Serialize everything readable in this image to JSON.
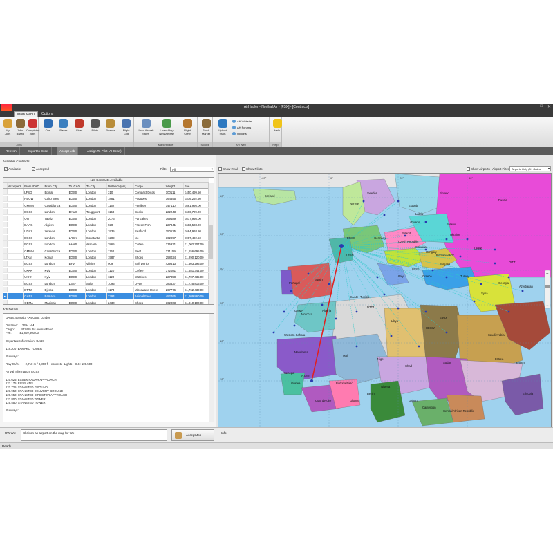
{
  "window": {
    "title": "AirHauler - NorthallAir - [FSX] - [Contracts]",
    "controls": [
      "–",
      "□",
      "✕"
    ]
  },
  "menu_tabs": [
    "Main Menu",
    "Options"
  ],
  "ribbon": {
    "groups": [
      {
        "label": "Jobs",
        "buttons": [
          {
            "label": "My\nJobs",
            "icon": "my-jobs-icon",
            "color": "#d9a23a"
          },
          {
            "label": "Jobs\nBoard",
            "icon": "jobs-board-icon",
            "color": "#8c6a3a"
          },
          {
            "label": "Completed\nJobs",
            "icon": "completed-jobs-icon",
            "color": "#cc3333"
          }
        ]
      },
      {
        "label": "",
        "buttons": [
          {
            "label": "Ops",
            "icon": "ops-icon",
            "color": "#2e6db4"
          },
          {
            "label": "Bases",
            "icon": "bases-icon",
            "color": "#3b7fbf"
          },
          {
            "label": "Fleet",
            "icon": "fleet-icon",
            "color": "#c0392b"
          },
          {
            "label": "Pilots",
            "icon": "pilots-icon",
            "color": "#555"
          },
          {
            "label": "Finance",
            "icon": "finance-icon",
            "color": "#b98d3a"
          },
          {
            "label": "Flight\nLog",
            "icon": "flight-log-icon",
            "color": "#4a74b0"
          }
        ]
      },
      {
        "label": "Marketplace",
        "buttons": [
          {
            "label": "Used Aircraft\nSales",
            "icon": "used-aircraft-icon",
            "color": "#6b8fbf"
          },
          {
            "label": "Lease/Buy\nNew Aircraft",
            "icon": "lease-buy-icon",
            "color": "#4a9a4a"
          },
          {
            "label": "Flight\nCrew",
            "icon": "flight-crew-icon",
            "color": "#b5772f"
          }
        ]
      },
      {
        "label": "Stocks",
        "buttons": [
          {
            "label": "Stock\nMarket",
            "icon": "stock-market-icon",
            "color": "#8a6b3a"
          }
        ]
      },
      {
        "label": "AH Web",
        "buttons": [
          {
            "label": "Upload\nStats",
            "icon": "upload-stats-icon",
            "color": "#2e79c0"
          }
        ],
        "links": [
          "AH Website",
          "AH Forums",
          "Options"
        ]
      },
      {
        "label": "Help",
        "buttons": [
          {
            "label": "Help",
            "icon": "help-icon",
            "color": "#f0c419"
          }
        ]
      }
    ]
  },
  "toolbar": [
    "Refresh",
    "Export to Excel",
    "Accept Job",
    "Assign To Pilot (AI Crew)"
  ],
  "contracts": {
    "section_label": "Available Contracts",
    "filter_available": "Available",
    "filter_accepted": "Accepted",
    "filter_label": "Filter",
    "filter_value": "All",
    "count_label": "128 Contracts Available",
    "columns": [
      "Accepted",
      "From ICAO",
      "From City",
      "To ICAO",
      "To City",
      "Distance (nm)",
      "Cargo",
      "Weight",
      "Fee"
    ],
    "rows": [
      [
        "",
        "LFSG",
        "Epinal",
        "EGSS",
        "London",
        "310",
        "Compact Discs",
        "100111",
        "£450,499.50"
      ],
      [
        "",
        "HECW",
        "Cairo West",
        "EGSS",
        "London",
        "1881",
        "Potatoes",
        "164655",
        "£576,292.50"
      ],
      [
        "",
        "GMMN",
        "Casablanca",
        "EGSS",
        "London",
        "1162",
        "Fertiliser",
        "147110",
        "£661,995.00"
      ],
      [
        "",
        "EGSS",
        "London",
        "DAUK",
        "Touggourt",
        "1158",
        "Books",
        "222243",
        "£666,729.00"
      ],
      [
        "",
        "OITT",
        "Tabriz",
        "EGSS",
        "London",
        "2076",
        "Pancakes",
        "169489",
        "£677,956.00"
      ],
      [
        "",
        "DAAG",
        "Algiers",
        "EGSS",
        "London",
        "920",
        "Frozen Fish",
        "227841",
        "£683,523.00"
      ],
      [
        "",
        "UDYZ",
        "Yerevan",
        "EGSS",
        "London",
        "1935",
        "Seafood",
        "150525",
        "£684,993.80"
      ],
      [
        "",
        "EGSS",
        "London",
        "LRCK",
        "Constanta",
        "1209",
        "Ice",
        "362997",
        "£907,492.50"
      ],
      [
        "",
        "EGSS",
        "London",
        "HHAS",
        "Asmara",
        "2865",
        "Coffee",
        "235931",
        "£1,002,707.00"
      ],
      [
        "",
        "GMMN",
        "Casablanca",
        "EGSS",
        "London",
        "1162",
        "Beef",
        "231159",
        "£1,156,695.00"
      ],
      [
        "",
        "LTAN",
        "Konya",
        "EGSS",
        "London",
        "1587",
        "Shoes",
        "258024",
        "£1,290,120.00"
      ],
      [
        "",
        "EGSS",
        "London",
        "EYVI",
        "Vilnius",
        "909",
        "Soft Drinks",
        "429513",
        "£1,503,296.00"
      ],
      [
        "",
        "UKKK",
        "Kyiv",
        "EGSS",
        "London",
        "1120",
        "Coffee",
        "372081",
        "£1,581,344.00"
      ],
      [
        "",
        "UKKK",
        "Kyiv",
        "EGSS",
        "London",
        "1120",
        "Watches",
        "227858",
        "£1,707,435.00"
      ],
      [
        "",
        "EGSS",
        "London",
        "LBSF",
        "Sofia",
        "1095",
        "DVDs",
        "383537",
        "£1,725,816.00"
      ],
      [
        "",
        "DTTJ",
        "Djerba",
        "EGSS",
        "London",
        "1173",
        "Microwave Ovens",
        "267776",
        "£1,762,432.00"
      ],
      [
        "",
        "GABS",
        "Bamako",
        "EGSS",
        "London",
        "2394",
        "Animal Feed",
        "452465",
        "£1,809,860.00"
      ],
      [
        "",
        "OEMA",
        "Madinah",
        "EGSS",
        "London",
        "2430",
        "Shoes",
        "362003",
        "£1,810,100.00"
      ]
    ],
    "selected_row": 16
  },
  "job_details": {
    "label": "Job Details",
    "lines": [
      "GABS, Bamako -> EGSS, London",
      "",
      "Distance:     2394 NM",
      "Cargo:        452465 lbs Animal Feed",
      "Fee:          £1,809,860.00",
      "",
      "Departure Information: GABS",
      "",
      "118.300  BAMAKO TOWER",
      "",
      "Runways:",
      "",
      "Rwy 06/24       2,710 m / 8,890 ft - concrete  Lights    ILS: 109.500",
      "",
      "Arrival Information: EGSS",
      "",
      "120.625  ESSEX RADAR APPROACH",
      "127.175  EGSS ATIS",
      "121.725  STANSTED GROUND",
      "121.950  STANSTED DELIVERY GROUND",
      "126.950  STANSTED DIRECTOR APPROACH",
      "123.800  STANSTED TOWER",
      "125.550  STANSTED TOWER",
      "",
      "Runways:"
    ]
  },
  "map": {
    "show_real": "Show Real",
    "show_pilots": "Show Pilots",
    "show_airports": "Show Airports",
    "airport_filter_label": "Airport Filter",
    "airport_filter_value": "Airports Only (3+ Gates)",
    "countries": [
      "Iceland",
      "Finland",
      "Sweden",
      "Norway",
      "Estonia",
      "Latvia",
      "Lithuania",
      "Belarus",
      "Russia",
      "Poland",
      "Germany",
      "Czech Republic",
      "Ukraine",
      "Slovakia",
      "Hungary",
      "Romania",
      "Bulgaria",
      "Italy",
      "Spain",
      "Portugal",
      "Greece",
      "Turkey",
      "Georgia",
      "Azerbaijan",
      "Iran",
      "Iraq",
      "Syria",
      "Jordan",
      "Egypt",
      "Libya",
      "Tunisia",
      "Algeria",
      "Morocco",
      "Western Sahara",
      "Mauritania",
      "Mali",
      "Niger",
      "Chad",
      "Sudan",
      "Nigeria",
      "Cameroon",
      "Central African Republic",
      "Ethiopia",
      "Saudi Arabia",
      "Yemen",
      "Oman",
      "Senegal",
      "Guinea",
      "Burkina Faso",
      "Cote d'Ivoire",
      "Ghana",
      "Benin",
      "Gabon",
      "Eritrea"
    ],
    "labels": [
      "Iceland",
      "Finland",
      "Sweden",
      "Norway",
      "Estonia",
      "Latvia",
      "Lithuania",
      "Belarus",
      "Russia",
      "Poland",
      "Germany",
      "Czech Republic",
      "Ukraine",
      "Slovakia",
      "Hungary",
      "Romania",
      "Bulgaria",
      "Italy",
      "Spain",
      "Portugal",
      "Greece",
      "Turkey",
      "Georgia",
      "Azerbaijan",
      "Syria",
      "Egypt",
      "Libya",
      "Tunisia",
      "Algeria",
      "Morocco",
      "Western Sahara",
      "Mauritania",
      "Mali",
      "Niger",
      "Chad",
      "Sudan",
      "Nigeria",
      "Cameroon",
      "Central African Republic",
      "Ethiopia",
      "Saudi Arabia",
      "Yemen",
      "Senegal",
      "Guinea",
      "Burkina Faso",
      "Cote d'Ivoire",
      "Ghana",
      "Benin",
      "Gabon",
      "Eritrea",
      "EGSS",
      "GABS",
      "LFSG",
      "HECW",
      "GMMN",
      "DAAG",
      "DTTJ",
      "LBSF",
      "LRCK",
      "UKKK",
      "OITT"
    ],
    "lat_labels": [
      "60°",
      "50°",
      "40°",
      "30°",
      "20°",
      "10°"
    ],
    "lon_labels": [
      "-20°",
      "0°",
      "20°",
      "40°"
    ],
    "zoom_levels": [
      "+",
      "−"
    ]
  },
  "bottom": {
    "rw_label": "RW Wx:",
    "rw_text": "Click on an airport on the map for Wx",
    "accept_label": "Accept Job",
    "info_label": "Info:"
  },
  "status": "Ready"
}
